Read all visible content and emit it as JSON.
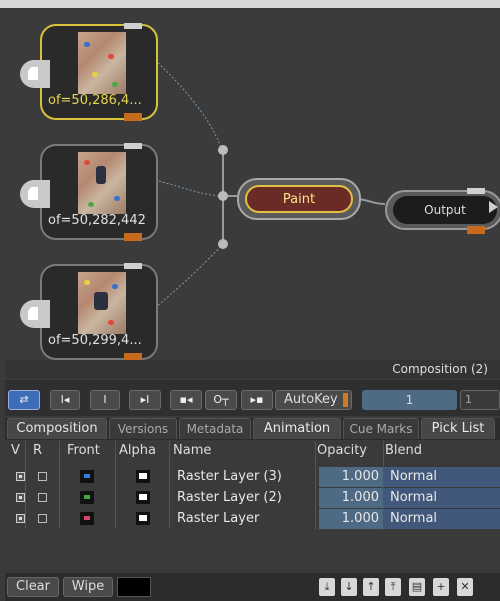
{
  "graph": {
    "nodes": [
      {
        "label": "of=50,286,4...",
        "selected": true
      },
      {
        "label": "of=50,282,442",
        "selected": false
      },
      {
        "label": "of=50,299,4...",
        "selected": false
      }
    ],
    "paint_label": "Paint",
    "output_label": "Output"
  },
  "composition_label": "Composition (2)",
  "toolbar": {
    "autokey_label": "AutoKey",
    "frame_value": "1",
    "frame_value2": "1"
  },
  "tabs": [
    "Composition",
    "Versions",
    "Metadata",
    "Animation",
    "Cue Marks",
    "Pick List"
  ],
  "table": {
    "columns": [
      "V",
      "R",
      "Front",
      "Alpha",
      "Name",
      "Opacity",
      "Blend"
    ],
    "rows": [
      {
        "name": "Raster Layer (3)",
        "opacity": "1.000",
        "blend": "Normal",
        "front_color": "#2f7fe0"
      },
      {
        "name": "Raster Layer (2)",
        "opacity": "1.000",
        "blend": "Normal",
        "front_color": "#3fa83f"
      },
      {
        "name": "Raster Layer",
        "opacity": "1.000",
        "blend": "Normal",
        "front_color": "#d8456a"
      }
    ]
  },
  "footer": {
    "clear_label": "Clear",
    "wipe_label": "Wipe"
  },
  "icons": [
    "loop-icon",
    "go-start-icon",
    "in-point-icon",
    "go-in-icon",
    "step-back-icon",
    "key-icon",
    "step-forward-icon",
    "move-down-icon",
    "move-down-small-icon",
    "move-up-small-icon",
    "move-up-icon",
    "layers-icon",
    "new-layer-icon",
    "delete-icon"
  ]
}
